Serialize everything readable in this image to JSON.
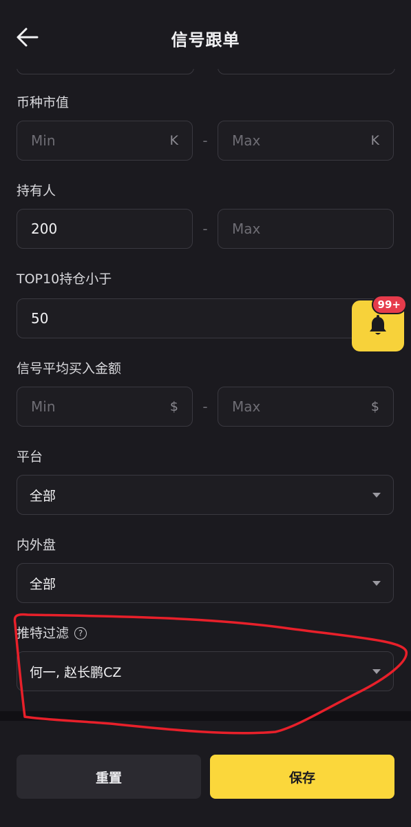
{
  "header": {
    "title": "信号跟单",
    "back_icon": "arrow-left-icon"
  },
  "fields": {
    "market_cap": {
      "label": "币种市值",
      "min_placeholder": "Min",
      "max_placeholder": "Max",
      "unit": "K",
      "separator": "-"
    },
    "holders": {
      "label": "持有人",
      "min_value": "200",
      "max_placeholder": "Max",
      "separator": "-"
    },
    "top10": {
      "label": "TOP10持仓小于",
      "value": "50"
    },
    "avg_buy": {
      "label": "信号平均买入金额",
      "min_placeholder": "Min",
      "max_placeholder": "Max",
      "unit": "$",
      "separator": "-"
    },
    "platform": {
      "label": "平台",
      "selected": "全部"
    },
    "pool": {
      "label": "内外盘",
      "selected": "全部"
    },
    "twitter": {
      "label": "推特过滤",
      "help_symbol": "?",
      "selected": "何一, 赵长鹏CZ"
    }
  },
  "notification": {
    "badge": "99+",
    "icon": "bell-icon"
  },
  "footer": {
    "reset_label": "重置",
    "save_label": "保存"
  },
  "colors": {
    "background": "#1b1a1f",
    "accent": "#fbd73b",
    "badge": "#e63b4b",
    "annotation": "#e8202a"
  }
}
